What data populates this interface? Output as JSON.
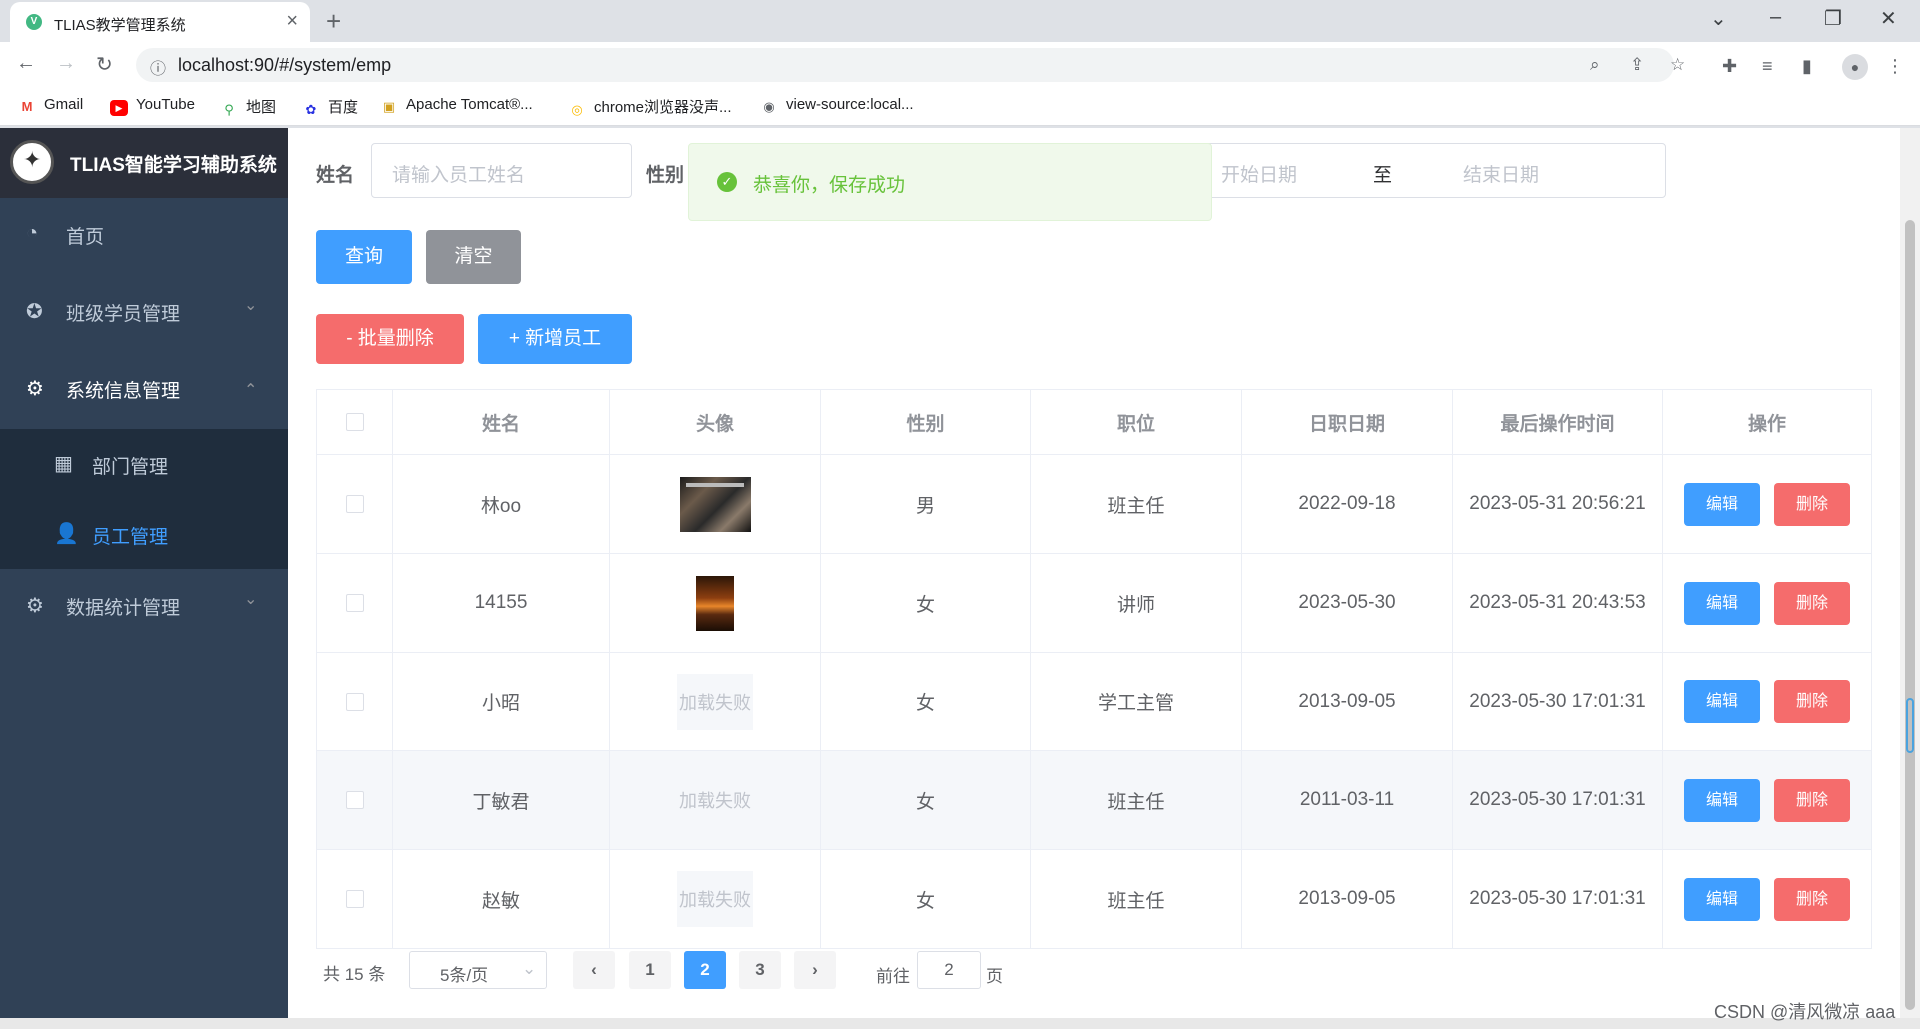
{
  "browser": {
    "tab_title": "TLIAS教学管理系统",
    "favicon_text": "V",
    "url": "localhost:90/#/system/emp",
    "bookmarks": [
      {
        "label": "Gmail",
        "icon": "gmail-icon"
      },
      {
        "label": "YouTube",
        "icon": "youtube-icon"
      },
      {
        "label": "地图",
        "icon": "maps-icon"
      },
      {
        "label": "百度",
        "icon": "baidu-icon"
      },
      {
        "label": "Apache Tomcat®...",
        "icon": "tomcat-icon"
      },
      {
        "label": "chrome浏览器没声...",
        "icon": "chrome-icon"
      },
      {
        "label": "view-source:local...",
        "icon": "globe-icon"
      }
    ]
  },
  "sidebar": {
    "logo_text": "TLIAS智能学习辅助系统",
    "menu": [
      {
        "label": "首页",
        "icon": "dashboard-icon"
      },
      {
        "label": "班级学员管理",
        "icon": "compass-icon"
      },
      {
        "label": "系统信息管理",
        "icon": "gear-icon"
      },
      {
        "label": "数据统计管理",
        "icon": "gear-icon"
      }
    ],
    "submenu": [
      {
        "label": "部门管理",
        "icon": "grid-icon"
      },
      {
        "label": "员工管理",
        "icon": "user-icon"
      }
    ]
  },
  "search": {
    "name_label": "姓名",
    "name_placeholder": "请输入员工姓名",
    "gender_label": "性别",
    "date_start_placeholder": "开始日期",
    "date_separator": "至",
    "date_end_placeholder": "结束日期",
    "query_label": "查询",
    "clear_label": "清空"
  },
  "toast": {
    "text": "恭喜你，保存成功"
  },
  "actions": {
    "batch_delete_label": "- 批量删除",
    "add_label": "+ 新增员工"
  },
  "table": {
    "headers": [
      "姓名",
      "头像",
      "性别",
      "职位",
      "日职日期",
      "最后操作时间",
      "操作"
    ],
    "edit_label": "编辑",
    "delete_label": "删除",
    "failed_text": "加载失败",
    "rows": [
      {
        "name": "林oo",
        "avatar": "image",
        "gender": "男",
        "position": "班主任",
        "entry_date": "2022-09-18",
        "update_time": "2023-05-31 20:56:21"
      },
      {
        "name": "14155",
        "avatar": "image",
        "gender": "女",
        "position": "讲师",
        "entry_date": "2023-05-30",
        "update_time": "2023-05-31 20:43:53"
      },
      {
        "name": "小昭",
        "avatar": "failed",
        "gender": "女",
        "position": "学工主管",
        "entry_date": "2013-09-05",
        "update_time": "2023-05-30 17:01:31"
      },
      {
        "name": "丁敏君",
        "avatar": "failed",
        "gender": "女",
        "position": "班主任",
        "entry_date": "2011-03-11",
        "update_time": "2023-05-30 17:01:31"
      },
      {
        "name": "赵敏",
        "avatar": "failed",
        "gender": "女",
        "position": "班主任",
        "entry_date": "2013-09-05",
        "update_time": "2023-05-30 17:01:31"
      }
    ]
  },
  "pagination": {
    "total_text": "共 15 条",
    "page_size": "5条/页",
    "pages": [
      "1",
      "2",
      "3"
    ],
    "current_page": "2",
    "goto_prefix": "前往",
    "goto_value": "2",
    "goto_suffix": "页"
  },
  "watermark": "CSDN @清风微凉 aaa"
}
